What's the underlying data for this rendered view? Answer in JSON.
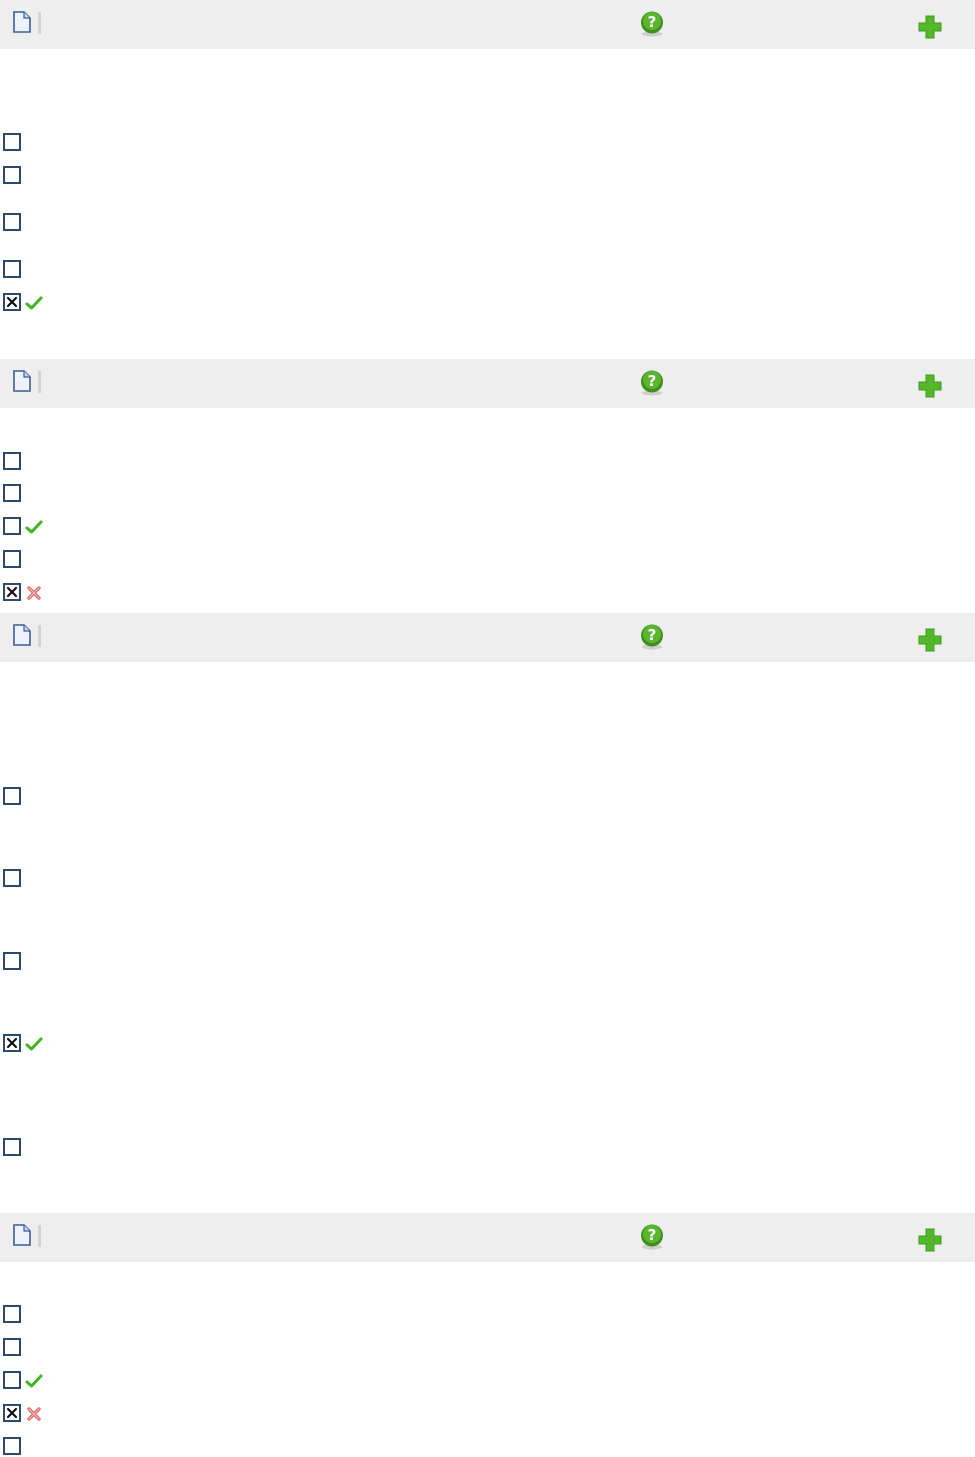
{
  "questions": [
    {
      "header_icons": [
        "document-icon",
        "help-icon",
        "add-icon"
      ],
      "options": [
        {
          "checked": false,
          "result": null
        },
        {
          "checked": false,
          "result": null
        },
        {
          "checked": false,
          "result": null
        },
        {
          "checked": false,
          "result": null
        },
        {
          "checked": true,
          "result": "correct"
        }
      ]
    },
    {
      "header_icons": [
        "document-icon",
        "help-icon",
        "add-icon"
      ],
      "options": [
        {
          "checked": false,
          "result": null
        },
        {
          "checked": false,
          "result": null
        },
        {
          "checked": false,
          "result": "correct"
        },
        {
          "checked": false,
          "result": null
        },
        {
          "checked": true,
          "result": "incorrect"
        }
      ]
    },
    {
      "header_icons": [
        "document-icon",
        "help-icon",
        "add-icon"
      ],
      "options": [
        {
          "checked": false,
          "result": null
        },
        {
          "checked": false,
          "result": null
        },
        {
          "checked": false,
          "result": null
        },
        {
          "checked": true,
          "result": "correct"
        },
        {
          "checked": false,
          "result": null
        }
      ]
    },
    {
      "header_icons": [
        "document-icon",
        "help-icon",
        "add-icon"
      ],
      "options": [
        {
          "checked": false,
          "result": null
        },
        {
          "checked": false,
          "result": null
        },
        {
          "checked": false,
          "result": "correct"
        },
        {
          "checked": true,
          "result": "incorrect"
        },
        {
          "checked": false,
          "result": null
        }
      ]
    }
  ],
  "colors": {
    "header_bg": "#eeeeee",
    "checkbox_border": "#2b4a6e",
    "correct_green": "#3cb81e",
    "incorrect_red": "#e06a6a",
    "help_green": "#3f8f1c",
    "add_green": "#52b82a"
  }
}
